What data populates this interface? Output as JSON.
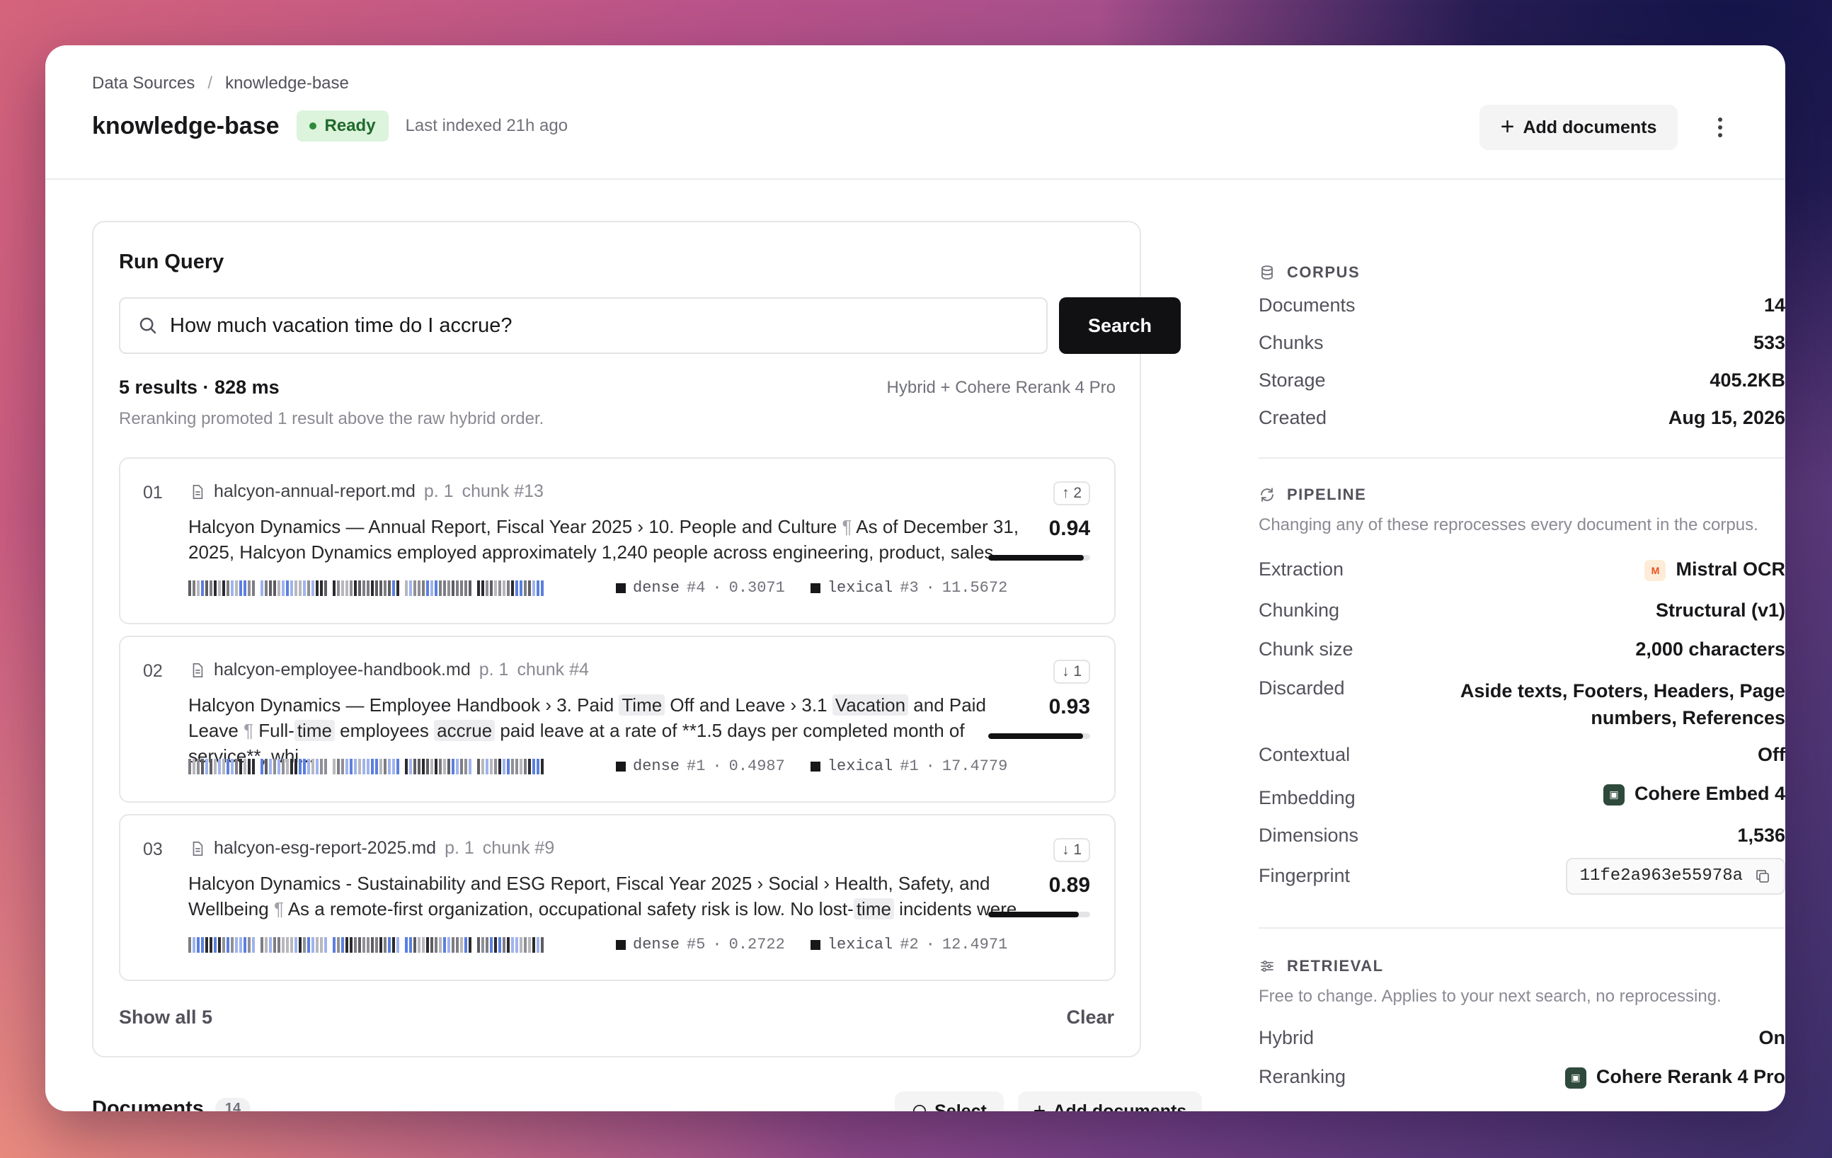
{
  "breadcrumb": {
    "parent": "Data Sources",
    "separator": "/",
    "current": "knowledge-base"
  },
  "header": {
    "title": "knowledge-base",
    "status": "Ready",
    "last_indexed": "Last indexed 21h ago",
    "add_documents_label": "Add documents"
  },
  "query": {
    "title": "Run Query",
    "input_value": "How much vacation time do I accrue?",
    "search_label": "Search",
    "summary": "5 results · 828 ms",
    "pipeline": "Hybrid + Cohere Rerank 4 Pro",
    "rerank_note": "Reranking promoted 1 result above the raw hybrid order.",
    "show_all_label": "Show all 5",
    "clear_label": "Clear"
  },
  "results": [
    {
      "rank": "01",
      "filename": "halcyon-annual-report.md",
      "page": "p. 1",
      "chunk": "chunk #13",
      "snippet_html": "Halcyon Dynamics — Annual Report, Fiscal Year 2025 › 10. People and Culture <span class=\"pil\">¶</span> As of December 31, 2025, Halcyon Dynamics employed approximately 1,240 people across engineering, product, sales, ...",
      "dense_label": "dense",
      "dense_rank": "#4",
      "dense_score": "0.3071",
      "lexical_label": "lexical",
      "lexical_rank": "#3",
      "lexical_score": "11.5672",
      "rank_change": "↑ 2",
      "score": "0.94",
      "score_fraction": 0.94,
      "seed": 3
    },
    {
      "rank": "02",
      "filename": "halcyon-employee-handbook.md",
      "page": "p. 1",
      "chunk": "chunk #4",
      "snippet_html": "Halcyon Dynamics — Employee Handbook › 3. Paid <span class=\"hl\">Time</span> Off and Leave › 3.1 <span class=\"hl\">Vacation</span> and Paid Leave <span class=\"pil\">¶</span> Full-<span class=\"hl\">time</span> employees <span class=\"hl\">accrue</span> paid leave at a rate of **1.5 days per completed month of service**, whi...",
      "dense_label": "dense",
      "dense_rank": "#1",
      "dense_score": "0.4987",
      "lexical_label": "lexical",
      "lexical_rank": "#1",
      "lexical_score": "17.4779",
      "rank_change": "↓ 1",
      "score": "0.93",
      "score_fraction": 0.93,
      "seed": 11
    },
    {
      "rank": "03",
      "filename": "halcyon-esg-report-2025.md",
      "page": "p. 1",
      "chunk": "chunk #9",
      "snippet_html": "Halcyon Dynamics - Sustainability and ESG Report, Fiscal Year 2025 › Social › Health, Safety, and Wellbeing <span class=\"pil\">¶</span> As a remote-first organization, occupational safety risk is low. No lost-<span class=\"hl\">time</span> incidents were...",
      "dense_label": "dense",
      "dense_rank": "#5",
      "dense_score": "0.2722",
      "lexical_label": "lexical",
      "lexical_rank": "#2",
      "lexical_score": "12.4971",
      "rank_change": "↓ 1",
      "score": "0.89",
      "score_fraction": 0.89,
      "seed": 23
    }
  ],
  "documents": {
    "title": "Documents",
    "count": "14",
    "select_label": "Select",
    "add_label": "Add documents"
  },
  "corpus": {
    "heading": "CORPUS",
    "rows": [
      {
        "k": "Documents",
        "v": "14"
      },
      {
        "k": "Chunks",
        "v": "533"
      },
      {
        "k": "Storage",
        "v": "405.2KB"
      },
      {
        "k": "Created",
        "v": "Aug 15, 2026"
      }
    ]
  },
  "pipeline": {
    "heading": "PIPELINE",
    "description": "Changing any of these reprocesses every document in the corpus.",
    "extraction_label": "Extraction",
    "extraction_value": "Mistral OCR",
    "chunking_label": "Chunking",
    "chunking_value": "Structural (v1)",
    "chunk_size_label": "Chunk size",
    "chunk_size_value": "2,000 characters",
    "discarded_label": "Discarded",
    "discarded_value": "Aside texts, Footers, Headers, Page numbers, References",
    "contextual_label": "Contextual",
    "contextual_value": "Off",
    "embedding_label": "Embedding",
    "embedding_value": "Cohere Embed 4",
    "dimensions_label": "Dimensions",
    "dimensions_value": "1,536",
    "fingerprint_label": "Fingerprint",
    "fingerprint_value": "11fe2a963e55978a"
  },
  "retrieval": {
    "heading": "RETRIEVAL",
    "description": "Free to change. Applies to your next search, no reprocessing.",
    "hybrid_label": "Hybrid",
    "hybrid_value": "On",
    "reranking_label": "Reranking",
    "reranking_value": "Cohere Rerank 4 Pro"
  },
  "colors": {
    "accent_dark": "#111113",
    "ready_bg": "#dcf3dc",
    "ready_text": "#1f6a2b",
    "spark_blue": "#5b7fe0",
    "spark_gray": "#8f8f96"
  }
}
